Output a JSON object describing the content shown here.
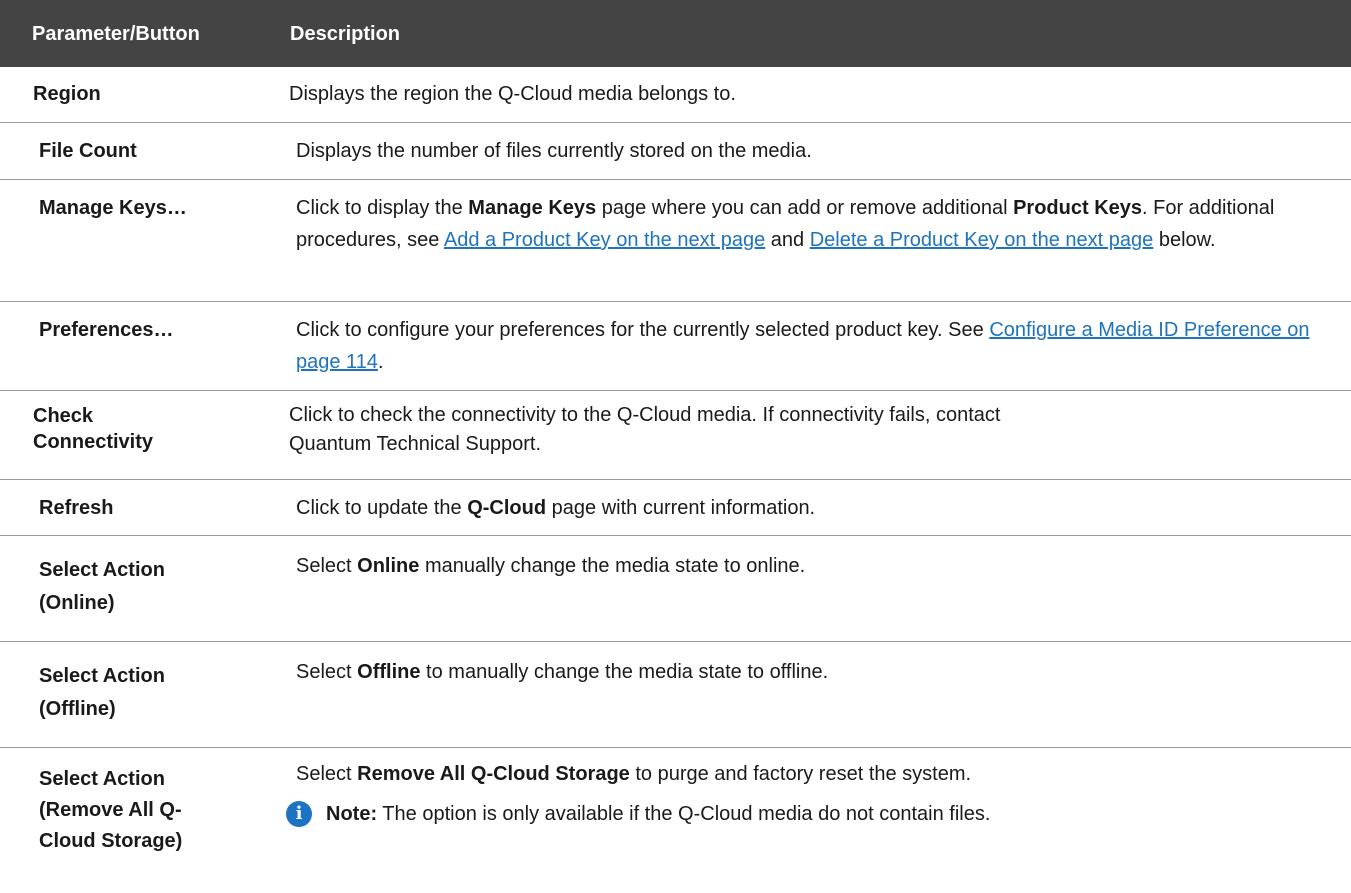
{
  "header": {
    "col_parameter": "Parameter/Button",
    "col_description": "Description"
  },
  "rows": [
    {
      "param": "Region",
      "desc": "Displays the region the Q-Cloud media belongs to."
    },
    {
      "param": "File Count",
      "desc": "Displays the number of files currently stored on the media."
    },
    {
      "param": "Manage Keys…",
      "d1": "Click to display the ",
      "b1": "Manage Keys",
      "d2": " page where you can add or remove additional ",
      "b2": "Product Keys",
      "d3": ". For additional procedures, see ",
      "link1": "Add a Product Key on the next page",
      "d4": " and ",
      "link2": "Delete a Product Key on the next page",
      "d5": " below."
    },
    {
      "param": "Preferences…",
      "d1": "Click to configure your preferences for the currently selected product key. See ",
      "link1": "Configure a Media ID Preference on page 114",
      "d2": "."
    },
    {
      "param_line1": "Check",
      "param_line2": "Connectivity",
      "desc_line1": "Click to check the connectivity to the Q-Cloud media. If connectivity fails, contact",
      "desc_line2": "Quantum Technical Support."
    },
    {
      "param": "Refresh",
      "d1": "Click to update the ",
      "b1": "Q-Cloud",
      "d2": " page with current information."
    },
    {
      "param_line1": "Select Action",
      "param_line2": "(Online)",
      "d1": "Select ",
      "b1": "Online",
      "d2": " manually change the media state to online."
    },
    {
      "param_line1": "Select Action",
      "param_line2": "(Offline)",
      "d1": "Select ",
      "b1": "Offline",
      "d2": " to manually change the media state to offline."
    },
    {
      "param_line1": "Select Action",
      "param_line2": "(Remove All Q-",
      "param_line3": "Cloud Storage)",
      "d1": "Select ",
      "b1": "Remove All Q-Cloud Storage",
      "d2": " to purge and factory reset the system.",
      "note_label": "Note:",
      "note_text": " The option is only available if the Q-Cloud media do not contain files.",
      "note_icon": "info-icon"
    }
  ],
  "colors": {
    "header_bg": "#444444",
    "link": "#1e73be",
    "info_icon": "#1c73c4"
  }
}
